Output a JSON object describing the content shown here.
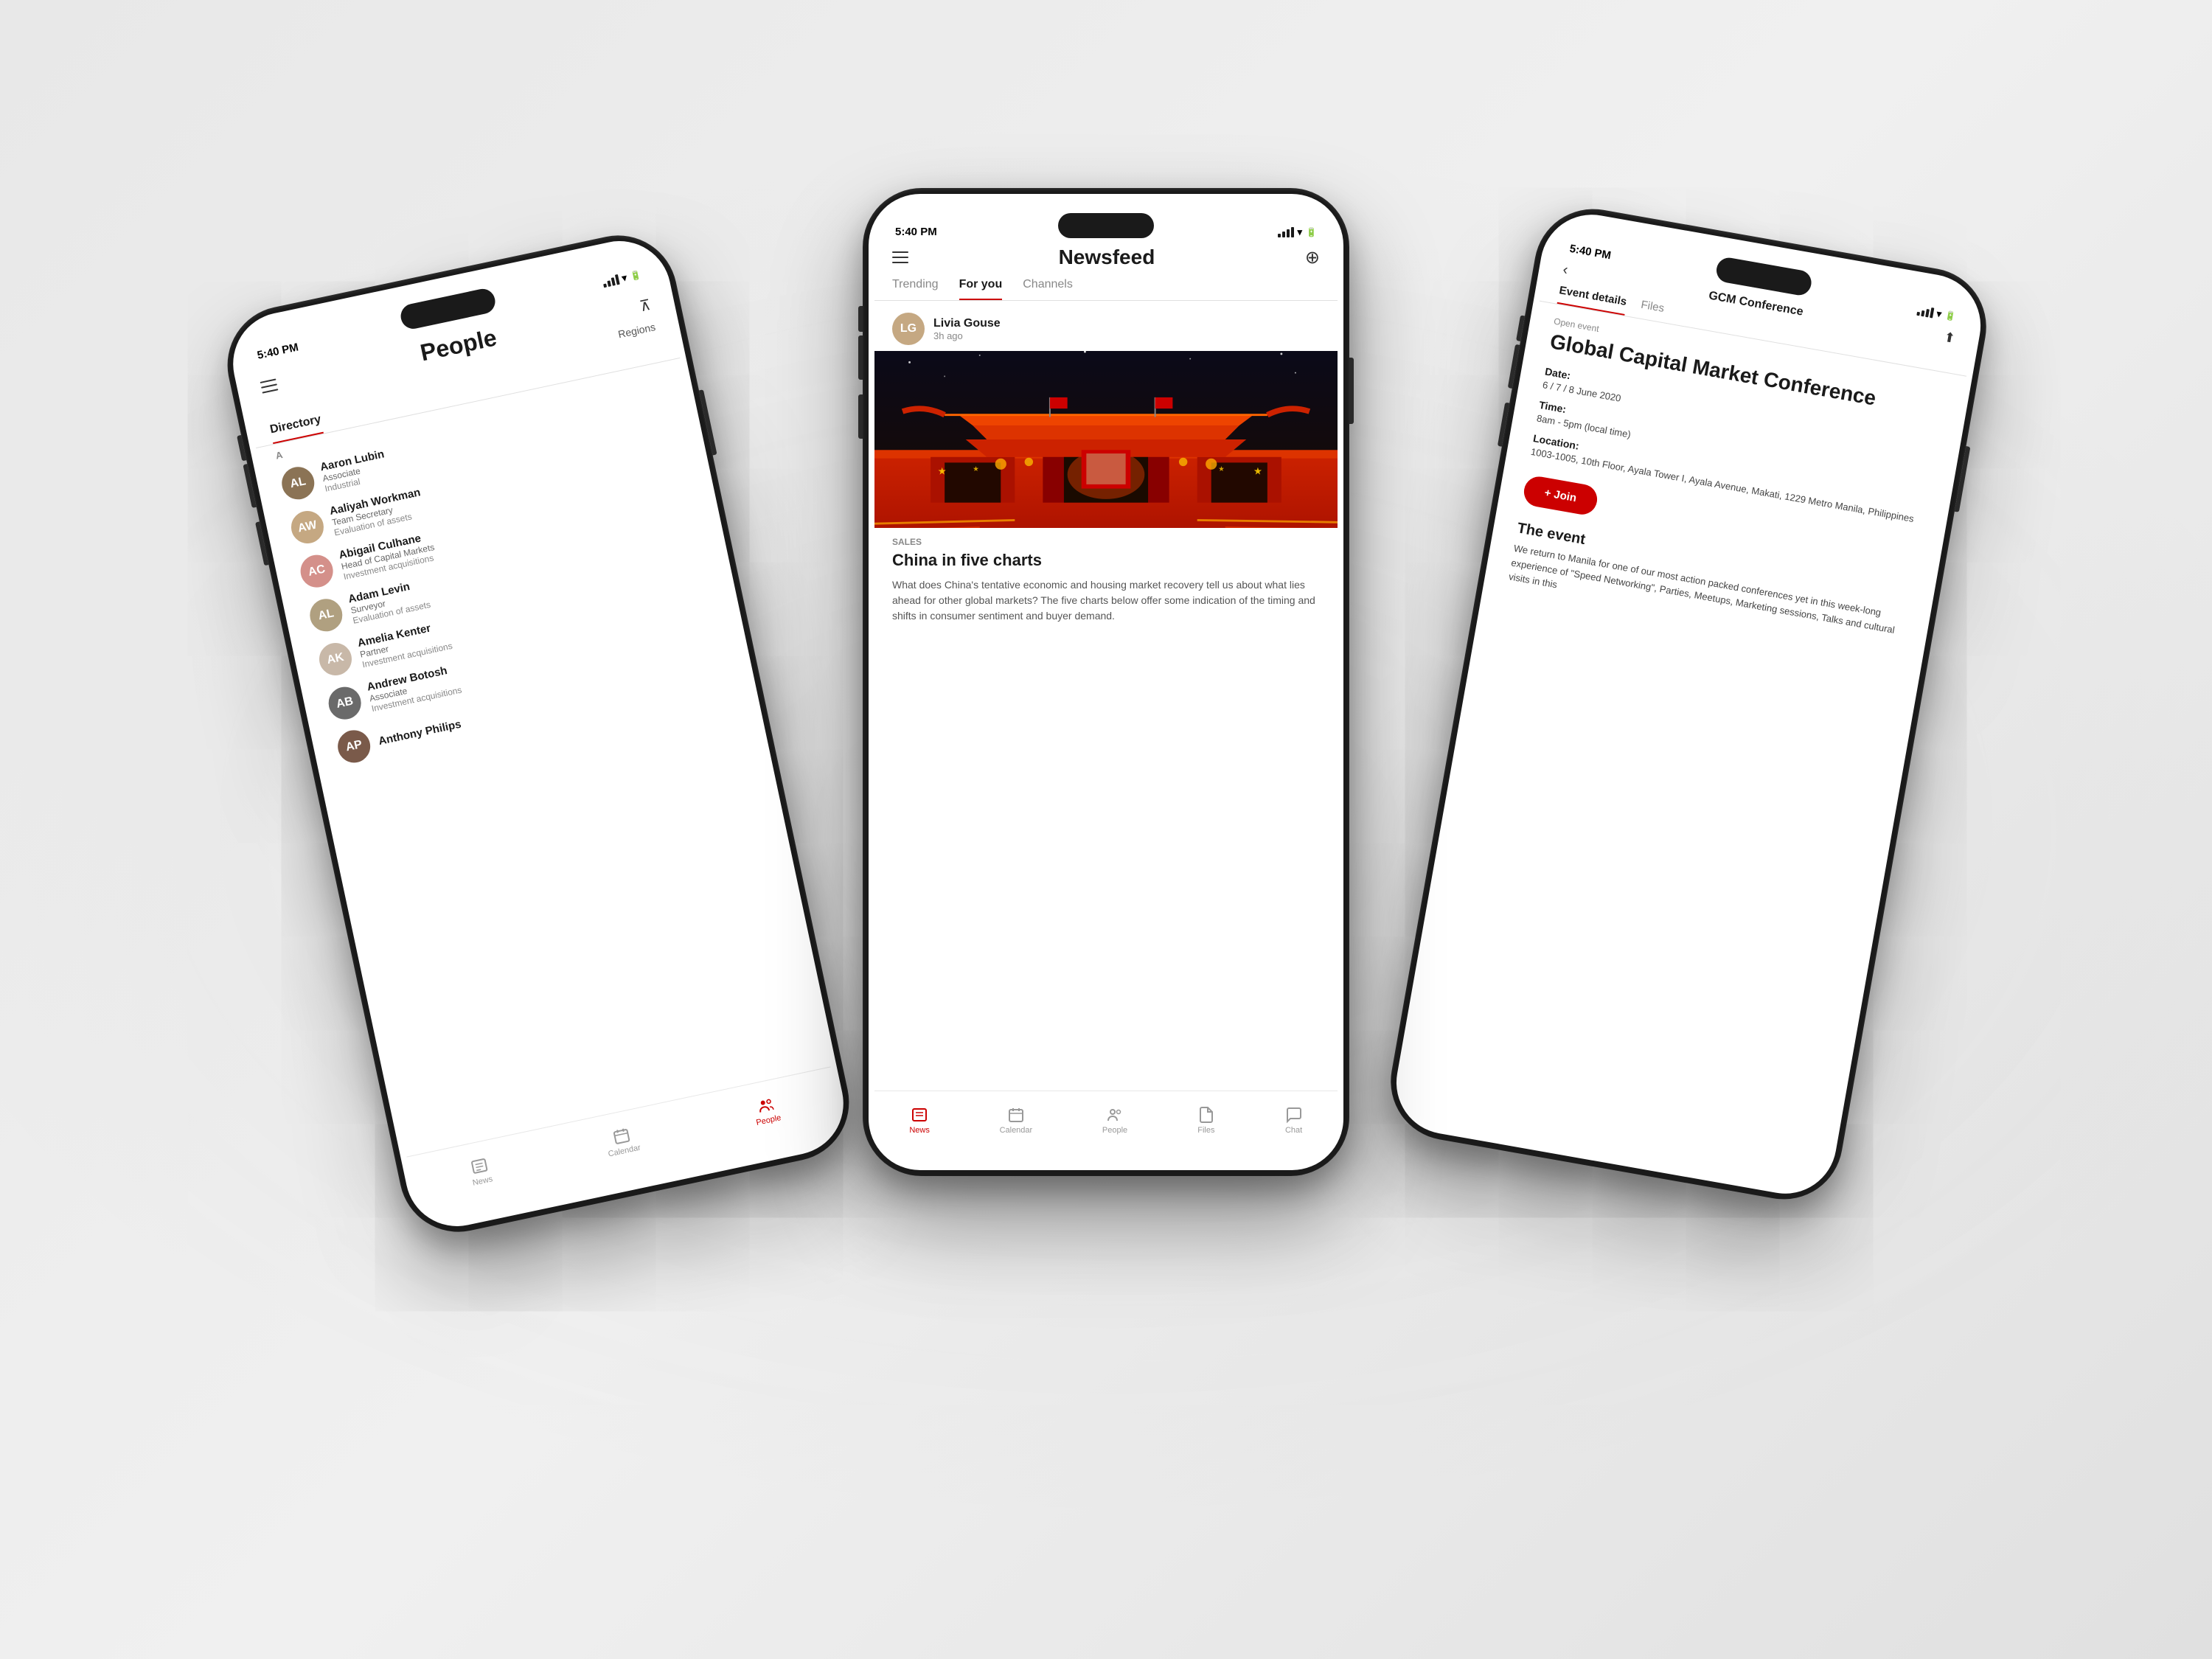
{
  "background": {
    "color": "#e8e8e8"
  },
  "phones": {
    "left": {
      "title": "People",
      "time": "5:40 PM",
      "tabs": [
        "Directory",
        "Regions"
      ],
      "active_tab": "Directory",
      "filter_icon": "filter",
      "people": [
        {
          "name": "Aaron Lubin",
          "role": "Associate",
          "dept": "Industrial",
          "initials": "AL",
          "color": "#8B7355"
        },
        {
          "name": "Aaliyah Workman",
          "role": "Team Secretary",
          "dept": "Evaluation of assets",
          "initials": "AW",
          "color": "#c5a882"
        },
        {
          "name": "Abigail Culhane",
          "role": "Head of Capital Markets",
          "dept": "Investment acquisitions",
          "initials": "AC",
          "color": "#d4908a"
        },
        {
          "name": "Adam Levin",
          "role": "Surveyor",
          "dept": "Evaluation of assets",
          "initials": "AL",
          "color": "#b0a080"
        },
        {
          "name": "Amelia Kenter",
          "role": "Partner",
          "dept": "Investment acquisitions",
          "initials": "AK",
          "color": "#c8b8a8"
        },
        {
          "name": "Andrew Botosh",
          "role": "Associate",
          "dept": "Investment acquisitions",
          "initials": "AB",
          "color": "#6a6a6a"
        },
        {
          "name": "Anthony Philips",
          "role": "",
          "dept": "",
          "initials": "AP",
          "color": "#7a5a4a"
        }
      ],
      "bottom_nav": [
        {
          "label": "News",
          "icon": "📰",
          "active": false
        },
        {
          "label": "Calendar",
          "icon": "📅",
          "active": false
        },
        {
          "label": "People",
          "icon": "👥",
          "active": true
        }
      ],
      "section_letter": "A"
    },
    "center": {
      "title": "Newsfeed",
      "time": "5:40 PM",
      "tabs": [
        "Trending",
        "For you",
        "Channels"
      ],
      "active_tab": "For you",
      "post": {
        "author": "Livia Gouse",
        "time": "3h ago",
        "author_initials": "LG",
        "category": "Sales",
        "title": "China in five charts",
        "excerpt": "What does China's tentative economic and housing market recovery tell us about what lies ahead for other global markets? The five charts below offer some indication of the timing and shifts in consumer sentiment and buyer demand."
      },
      "bottom_nav": [
        {
          "label": "News",
          "icon": "📰",
          "active": true
        },
        {
          "label": "Calendar",
          "icon": "📅",
          "active": false
        },
        {
          "label": "People",
          "icon": "👥",
          "active": false
        },
        {
          "label": "Files",
          "icon": "📄",
          "active": false
        },
        {
          "label": "Chat",
          "icon": "💬",
          "active": false
        }
      ]
    },
    "right": {
      "title": "GCM Conference",
      "time": "5:40 PM",
      "tabs": [
        "Event details",
        "Files"
      ],
      "active_tab": "Event details",
      "event": {
        "type": "Open event",
        "title": "Global Capital Market Conference",
        "date_label": "Date:",
        "date_value": "6 / 7 / 8 June 2020",
        "time_label": "Time:",
        "time_value": "8am - 5pm (local time)",
        "location_label": "Location:",
        "location_value": "1003-1005, 10th Floor, Ayala Tower I, Ayala Avenue, Makati, 1229 Metro Manila, Philippines",
        "join_button": "+ Join",
        "section_title": "The event",
        "body": "We return to Manila for one of our most action packed conferences yet in this week-long experience of \"Speed Networking\", Parties, Meetups, Marketing sessions, Talks and cultural visits in this"
      }
    }
  }
}
